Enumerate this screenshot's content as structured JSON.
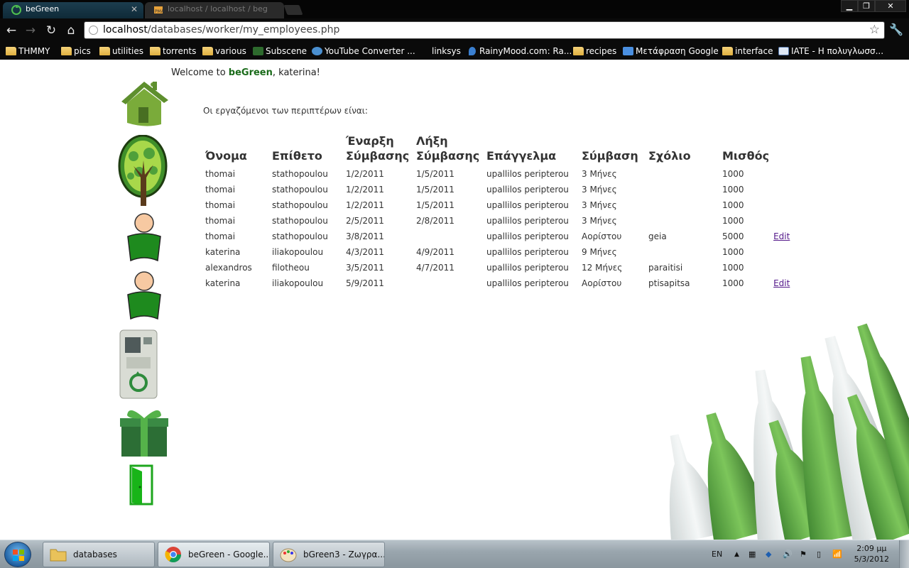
{
  "browser": {
    "tabs": [
      {
        "title": "beGreen",
        "active": true
      },
      {
        "title": "localhost / localhost / beg",
        "active": false
      }
    ],
    "url_host": "localhost",
    "url_path": "/databases/worker/my_employees.php",
    "bookmarks": [
      {
        "label": "THMMY",
        "icon": "folder"
      },
      {
        "label": "pics",
        "icon": "folder"
      },
      {
        "label": "utilities",
        "icon": "folder"
      },
      {
        "label": "torrents",
        "icon": "folder"
      },
      {
        "label": "various",
        "icon": "folder"
      },
      {
        "label": "Subscene",
        "icon": "subscene-icon"
      },
      {
        "label": "YouTube Converter ...",
        "icon": "converter-icon"
      },
      {
        "label": "linksys",
        "icon": "none"
      },
      {
        "label": "RainyMood.com: Ra...",
        "icon": "raindrop-icon"
      },
      {
        "label": "recipes",
        "icon": "folder"
      },
      {
        "label": "Μετάφραση Google",
        "icon": "google-translate-icon"
      },
      {
        "label": "interface",
        "icon": "folder"
      },
      {
        "label": "IATE - Η πολυγλωσσ...",
        "icon": "iate-icon"
      }
    ]
  },
  "page": {
    "welcome_prefix": "Welcome to ",
    "brand": "beGreen",
    "welcome_suffix": ", katerina!",
    "intro": "Οι εργαζόμενοι των περιπτέρων είναι:",
    "sidebar_icons": [
      "house-icon",
      "tree-icon",
      "person-icon",
      "person-icon",
      "recycling-machine-icon",
      "gift-icon",
      "door-exit-icon"
    ],
    "table": {
      "headers": [
        "Όνομα",
        "Επίθετο",
        "Έναρξη Σύμβασης",
        "Λήξη Σύμβασης",
        "Επάγγελμα",
        "Σύμβαση",
        "Σχόλιο",
        "Μισθός",
        ""
      ],
      "rows": [
        [
          "thomai",
          "stathopoulou",
          "1/2/2011",
          "1/5/2011",
          "upallilos peripterou",
          "3 Μήνες",
          "",
          "1000",
          ""
        ],
        [
          "thomai",
          "stathopoulou",
          "1/2/2011",
          "1/5/2011",
          "upallilos peripterou",
          "3 Μήνες",
          "",
          "1000",
          ""
        ],
        [
          "thomai",
          "stathopoulou",
          "1/2/2011",
          "1/5/2011",
          "upallilos peripterou",
          "3 Μήνες",
          "",
          "1000",
          ""
        ],
        [
          "thomai",
          "stathopoulou",
          "2/5/2011",
          "2/8/2011",
          "upallilos peripterou",
          "3 Μήνες",
          "",
          "1000",
          ""
        ],
        [
          "thomai",
          "stathopoulou",
          "3/8/2011",
          "",
          "upallilos peripterou",
          "Αορίστου",
          "geia",
          "5000",
          "Edit"
        ],
        [
          "katerina",
          "iliakopoulou",
          "4/3/2011",
          "4/9/2011",
          "upallilos peripterou",
          "9 Μήνες",
          "",
          "1000",
          ""
        ],
        [
          "alexandros",
          "filotheou",
          "3/5/2011",
          "4/7/2011",
          "upallilos peripterou",
          "12 Μήνες",
          "paraitisi",
          "1000",
          ""
        ],
        [
          "katerina",
          "iliakopoulou",
          "5/9/2011",
          "",
          "upallilos peripterou",
          "Αορίστου",
          "ptisapitsa",
          "1000",
          "Edit"
        ]
      ]
    }
  },
  "taskbar": {
    "items": [
      {
        "label": "databases",
        "icon": "folder-icon"
      },
      {
        "label": "beGreen - Google...",
        "icon": "chrome-icon"
      },
      {
        "label": "bGreen3 - Ζωγρα...",
        "icon": "paint-icon"
      }
    ],
    "language": "EN",
    "time": "2:09 μμ",
    "date": "5/3/2012"
  },
  "colors": {
    "brand_green": "#1a6b1a",
    "link_visited": "#551a8b"
  }
}
